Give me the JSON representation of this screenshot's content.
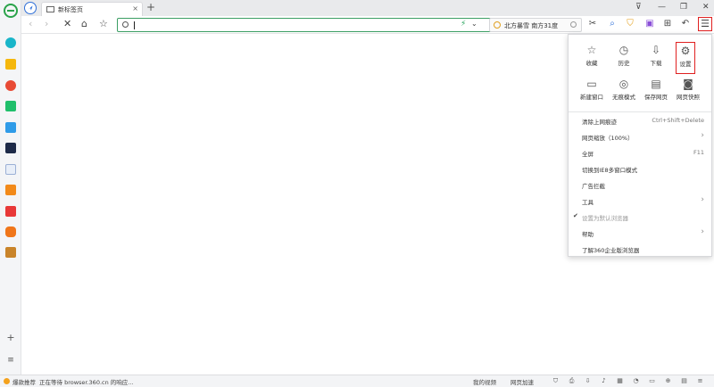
{
  "window": {
    "tab_title": "新标签页",
    "tab_close": "×",
    "new_tab": "+",
    "controls": [
      "⊽",
      "—",
      "❐",
      "✕"
    ]
  },
  "nav": {
    "back": "‹",
    "forward": "›",
    "stop": "✕",
    "home": "⌂",
    "favorite": "☆"
  },
  "address_bar": {
    "value": "",
    "accelerate_icon": "lightning-icon",
    "dropdown": "⌄"
  },
  "weather": {
    "text": "北方暴雪 南方31度"
  },
  "toolbar_icons": [
    "scissors-icon",
    "search-lens-icon",
    "shield-icon",
    "extension-icon",
    "grid-icon",
    "undo-icon"
  ],
  "menu_button": "☰",
  "menu": {
    "grid_row1": [
      {
        "label": "收藏",
        "icon": "☆",
        "name": "star-icon"
      },
      {
        "label": "历史",
        "icon": "◷",
        "name": "clock-icon"
      },
      {
        "label": "下载",
        "icon": "⇩",
        "name": "download-icon"
      },
      {
        "label": "设置",
        "icon": "⚙",
        "name": "gear-icon"
      }
    ],
    "grid_row2": [
      {
        "label": "新建窗口",
        "icon": "▭",
        "name": "window-icon"
      },
      {
        "label": "无痕模式",
        "icon": "◎",
        "name": "incognito-icon"
      },
      {
        "label": "保存网页",
        "icon": "▤",
        "name": "save-page-icon"
      },
      {
        "label": "网页快照",
        "icon": "◙",
        "name": "camera-icon"
      }
    ],
    "rows": [
      {
        "label": "清除上网痕迹",
        "shortcut": "Ctrl+Shift+Delete"
      },
      {
        "label": "网页缩放（100%）",
        "arrow": "›"
      },
      {
        "label": "全屏",
        "shortcut": "F11"
      },
      {
        "label": "切换到IE8多窗口模式"
      },
      {
        "label": "广告拦截"
      },
      {
        "label": "工具",
        "arrow": "›"
      },
      {
        "label": "设置为默认浏览器",
        "check": "✔"
      },
      {
        "label": "帮助",
        "arrow": "›"
      },
      {
        "label": "了解360企业版浏览器"
      }
    ]
  },
  "status": {
    "recommend": "爆款推荐",
    "waiting": "正在等待 browser.360.cn 的响应...",
    "video": "我的视频",
    "speed": "网页加速"
  },
  "colors": {
    "accent_green": "#3b9e63",
    "highlight_red": "#e02020",
    "brand_blue": "#2f6fd8"
  }
}
